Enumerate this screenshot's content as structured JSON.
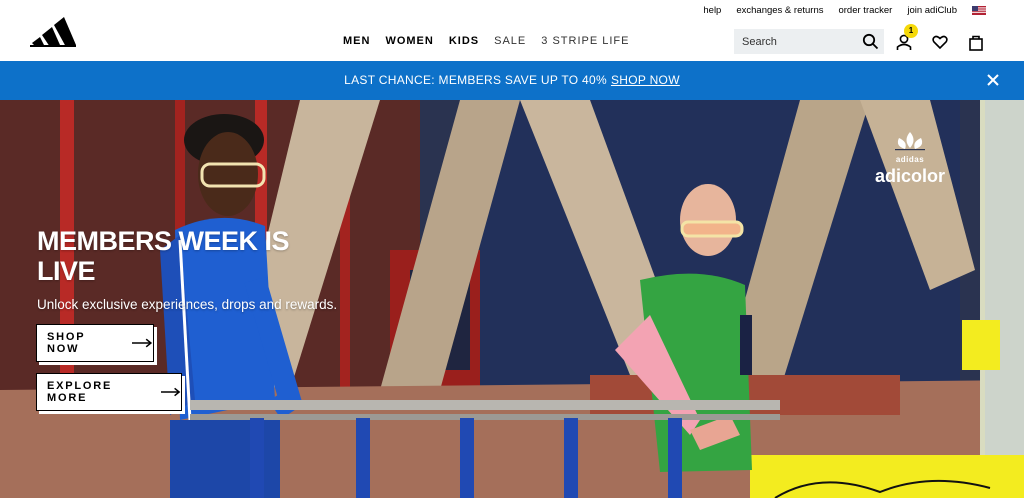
{
  "utility": {
    "links": [
      "help",
      "exchanges & returns",
      "order tracker",
      "join adiClub"
    ],
    "flag_icon": "us-flag-icon"
  },
  "nav": {
    "items": [
      {
        "label": "MEN",
        "bold": true
      },
      {
        "label": "WOMEN",
        "bold": true
      },
      {
        "label": "KIDS",
        "bold": true
      },
      {
        "label": "SALE",
        "bold": false
      },
      {
        "label": "3 STRIPE LIFE",
        "bold": false
      }
    ]
  },
  "search": {
    "placeholder": "Search"
  },
  "account": {
    "badge_count": "1"
  },
  "promo": {
    "text": "LAST CHANCE: MEMBERS SAVE UP TO 40%",
    "link": "SHOP NOW",
    "background": "#0d71c9"
  },
  "hero": {
    "brand_small": "adidas",
    "brand_big": "adicolor",
    "title": "MEMBERS WEEK IS LIVE",
    "subtitle": "Unlock exclusive experiences, drops and rewards.",
    "cta_primary": "SHOP NOW",
    "cta_secondary": "EXPLORE MORE"
  },
  "colors": {
    "accent_yellow": "#f3ec1f",
    "badge_yellow": "#f5d90a"
  }
}
